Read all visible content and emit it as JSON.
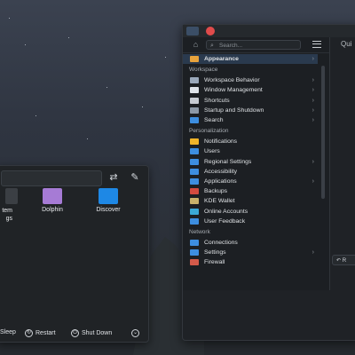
{
  "launcher": {
    "apps": [
      {
        "label": "tem\ngs",
        "color": "#cfd6dd"
      },
      {
        "label": "Dolphin",
        "color": "#b07fdf"
      },
      {
        "label": "Discover",
        "color": "#1e88e5"
      }
    ],
    "power": {
      "sleep": "Sleep",
      "restart": "Restart",
      "shutdown": "Shut Down"
    }
  },
  "settings": {
    "search_placeholder": "Search...",
    "quick_title": "Qui",
    "bottom_button": "R",
    "selected": "Appearance",
    "sections": [
      {
        "heading": "",
        "items": [
          {
            "label": "Appearance",
            "color": "#e8a33c",
            "chevron": true,
            "selected": true
          }
        ]
      },
      {
        "heading": "Workspace",
        "items": [
          {
            "label": "Workspace Behavior",
            "color": "#9aa8ba",
            "chevron": true
          },
          {
            "label": "Window Management",
            "color": "#dfe4ea",
            "chevron": true
          },
          {
            "label": "Shortcuts",
            "color": "#c7ccd3",
            "chevron": true
          },
          {
            "label": "Startup and Shutdown",
            "color": "#8c98a6",
            "chevron": true
          },
          {
            "label": "Search",
            "color": "#3d8ee0",
            "chevron": true
          }
        ]
      },
      {
        "heading": "Personalization",
        "items": [
          {
            "label": "Notifications",
            "color": "#f0b429",
            "chevron": false
          },
          {
            "label": "Users",
            "color": "#3d8ee0",
            "chevron": false
          },
          {
            "label": "Regional Settings",
            "color": "#3d8ee0",
            "chevron": true
          },
          {
            "label": "Accessibility",
            "color": "#3d8ee0",
            "chevron": false
          },
          {
            "label": "Applications",
            "color": "#3d8ee0",
            "chevron": true
          },
          {
            "label": "Backups",
            "color": "#d34b3f",
            "chevron": false
          },
          {
            "label": "KDE Wallet",
            "color": "#c9b26a",
            "chevron": false
          },
          {
            "label": "Online Accounts",
            "color": "#3ba9d6",
            "chevron": false
          },
          {
            "label": "User Feedback",
            "color": "#3d8ee0",
            "chevron": false
          }
        ]
      },
      {
        "heading": "Network",
        "items": [
          {
            "label": "Connections",
            "color": "#3d8ee0",
            "chevron": false
          },
          {
            "label": "Settings",
            "color": "#3d8ee0",
            "chevron": true
          },
          {
            "label": "Firewall",
            "color": "#d35a4a",
            "chevron": false
          }
        ]
      }
    ]
  }
}
